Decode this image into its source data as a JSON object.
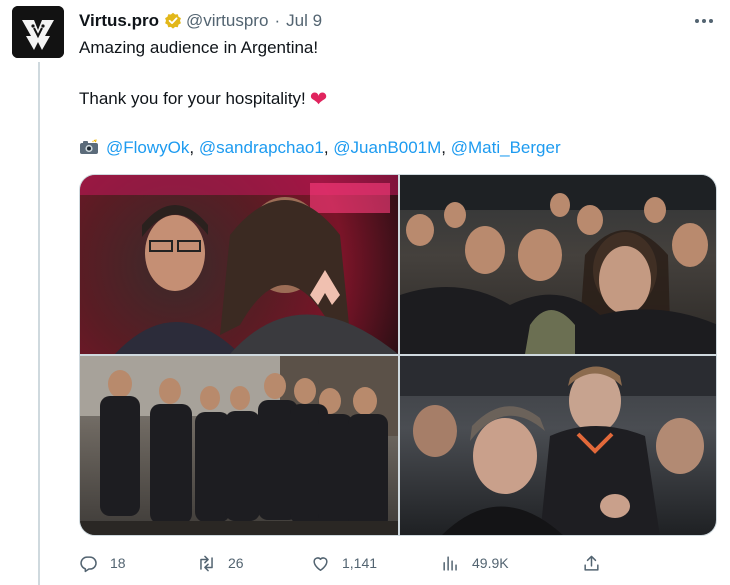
{
  "account": {
    "name": "Virtus.pro",
    "handle": "@virtuspro",
    "separator": "·",
    "date": "Jul 9"
  },
  "tweet": {
    "line1": "Amazing audience in Argentina!",
    "line2": "Thank you for your hospitality!",
    "line2_emoji": "❤",
    "credits_prefix_icon": "camera-with-flash-icon",
    "mentions": [
      "@FlowyOk",
      "@sandrapchao1",
      "@JuanB001M",
      "@Mati_Berger"
    ],
    "mention_separator": ", "
  },
  "photos": [
    {
      "id": "photo-1"
    },
    {
      "id": "photo-2"
    },
    {
      "id": "photo-3"
    },
    {
      "id": "photo-4"
    }
  ],
  "actions": {
    "replies": "18",
    "reposts": "26",
    "likes": "1,141",
    "views": "49.9K"
  },
  "colors": {
    "accent": "#1d9bf0",
    "muted": "#536471",
    "verified": "#e2b719",
    "heart": "#e0245e",
    "thread_line": "#cfd9de"
  }
}
